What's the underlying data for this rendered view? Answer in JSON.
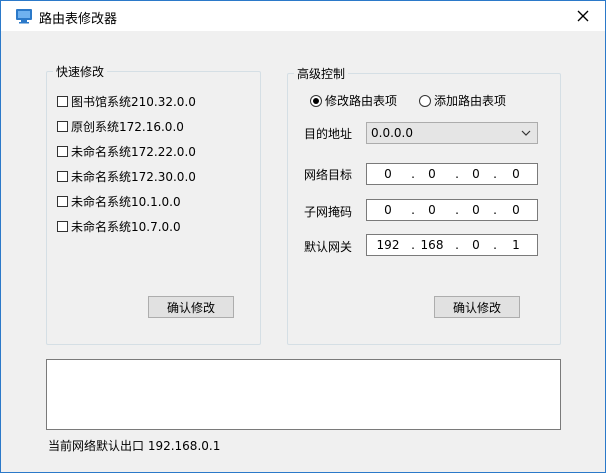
{
  "window": {
    "title": "路由表修改器",
    "close_glyph": "✕"
  },
  "quick": {
    "legend": "快速修改",
    "items": [
      {
        "label": "图书馆系统210.32.0.0",
        "checked": false
      },
      {
        "label": "原创系统172.16.0.0",
        "checked": false
      },
      {
        "label": "未命名系统172.22.0.0",
        "checked": false
      },
      {
        "label": "未命名系统172.30.0.0",
        "checked": false
      },
      {
        "label": "未命名系统10.1.0.0",
        "checked": false
      },
      {
        "label": "未命名系统10.7.0.0",
        "checked": false
      }
    ],
    "confirm_label": "确认修改"
  },
  "advanced": {
    "legend": "高级控制",
    "modes": [
      {
        "label": "修改路由表项",
        "selected": true
      },
      {
        "label": "添加路由表项",
        "selected": false
      }
    ],
    "dest_label": "目的地址",
    "dest_value": "0.0.0.0",
    "fields": [
      {
        "label": "网络目标",
        "octets": [
          "0",
          "0",
          "0",
          "0"
        ]
      },
      {
        "label": "子网掩码",
        "octets": [
          "0",
          "0",
          "0",
          "0"
        ]
      },
      {
        "label": "默认网关",
        "octets": [
          "192",
          "168",
          "0",
          "1"
        ]
      }
    ],
    "confirm_label": "确认修改"
  },
  "output": {
    "text": ""
  },
  "status": {
    "text": "当前网络默认出口 192.168.0.1"
  },
  "colors": {
    "accent": "#2b79c9",
    "window_bg": "#f0f0f0",
    "button_bg": "#e1e1e1"
  }
}
